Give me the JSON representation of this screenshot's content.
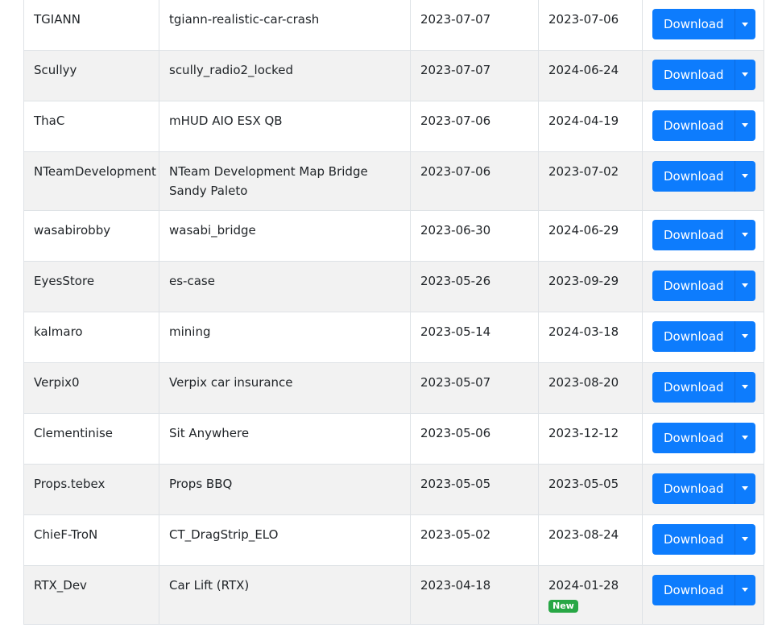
{
  "table": {
    "rows": [
      {
        "author": "TGIANN",
        "name": "tgiann-realistic-car-crash",
        "date1": "2023-07-07",
        "date2": "2023-07-06",
        "badge": "",
        "button": "Download"
      },
      {
        "author": "Scullyy",
        "name": "scully_radio2_locked",
        "date1": "2023-07-07",
        "date2": "2024-06-24",
        "badge": "",
        "button": "Download"
      },
      {
        "author": "ThaC",
        "name": "mHUD AIO ESX QB",
        "date1": "2023-07-06",
        "date2": "2024-04-19",
        "badge": "",
        "button": "Download"
      },
      {
        "author": "NTeamDevelopment",
        "name": "NTeam Development Map Bridge Sandy Paleto",
        "date1": "2023-07-06",
        "date2": "2023-07-02",
        "badge": "",
        "button": "Download"
      },
      {
        "author": "wasabirobby",
        "name": "wasabi_bridge",
        "date1": "2023-06-30",
        "date2": "2024-06-29",
        "badge": "",
        "button": "Download"
      },
      {
        "author": "EyesStore",
        "name": "es-case",
        "date1": "2023-05-26",
        "date2": "2023-09-29",
        "badge": "",
        "button": "Download"
      },
      {
        "author": "kalmaro",
        "name": "mining",
        "date1": "2023-05-14",
        "date2": "2024-03-18",
        "badge": "",
        "button": "Download"
      },
      {
        "author": "Verpix0",
        "name": "Verpix car insurance",
        "date1": "2023-05-07",
        "date2": "2023-08-20",
        "badge": "",
        "button": "Download"
      },
      {
        "author": "Clementinise",
        "name": "Sit Anywhere",
        "date1": "2023-05-06",
        "date2": "2023-12-12",
        "badge": "",
        "button": "Download"
      },
      {
        "author": "Props.tebex",
        "name": "Props BBQ",
        "date1": "2023-05-05",
        "date2": "2023-05-05",
        "badge": "",
        "button": "Download"
      },
      {
        "author": "ChieF-TroN",
        "name": "CT_DragStrip_ELO",
        "date1": "2023-05-02",
        "date2": "2023-08-24",
        "badge": "",
        "button": "Download"
      },
      {
        "author": "RTX_Dev",
        "name": "Car Lift (RTX)",
        "date1": "2023-04-18",
        "date2": "2024-01-28",
        "badge": "New",
        "button": "Download"
      }
    ]
  },
  "colors": {
    "button": "#0d7cfd",
    "badge": "#28a745",
    "row_alt": "#f2f2f2",
    "border": "#dee2e6"
  }
}
